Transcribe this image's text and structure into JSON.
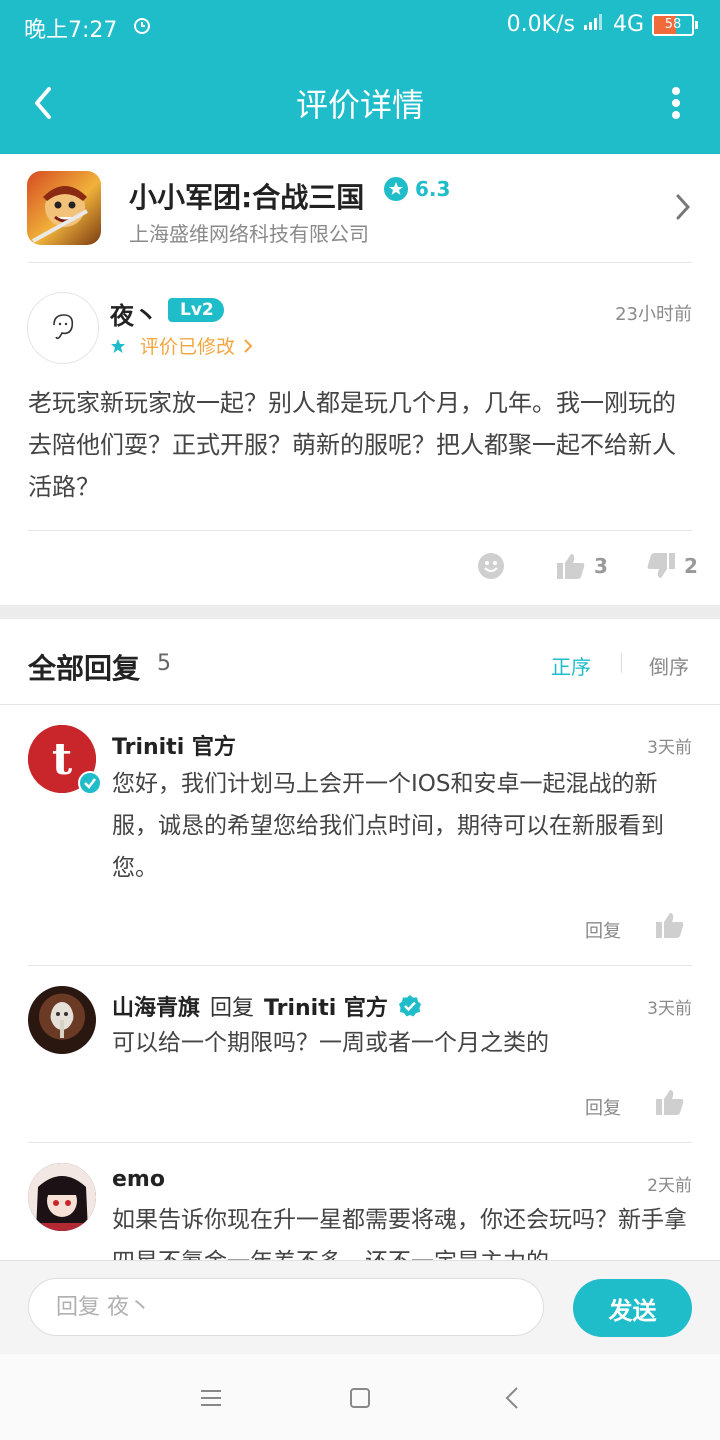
{
  "status_bar": {
    "time": "晚上7:27",
    "network_speed": "0.0K/s",
    "network_type": "4G",
    "battery": "58"
  },
  "header": {
    "title": "评价详情"
  },
  "app": {
    "name": "小小军团:合战三国",
    "rating": "6.3",
    "developer": "上海盛维网络科技有限公司"
  },
  "review": {
    "user": "夜丶",
    "level": "Lv2",
    "time": "23小时前",
    "modified_label": "评价已修改",
    "text": "老玩家新玩家放一起？别人都是玩几个月，几年。我一刚玩的去陪他们耍？正式开服？萌新的服呢？把人都聚一起不给新人活路？",
    "likes": "3",
    "dislikes": "2"
  },
  "replies_section": {
    "title": "全部回复",
    "count": "5",
    "sort_asc": "正序",
    "sort_desc": "倒序",
    "reply_label": "回复"
  },
  "replies": [
    {
      "user": "Triniti 官方",
      "avatar_letter": "t",
      "time": "3天前",
      "text": "您好，我们计划马上会开一个IOS和安卓一起混战的新服，诚恳的希望您给我们点时间，期待可以在新服看到您。"
    },
    {
      "user": "山海青旗",
      "reply_word": "回复",
      "reply_to": "Triniti 官方",
      "time": "3天前",
      "text": "可以给一个期限吗？一周或者一个月之类的"
    },
    {
      "user": "emo",
      "time": "2天前",
      "text": "如果告诉你现在升一星都需要将魂，你还会玩吗？新手拿四星不氪金一年差不多，还不一定是主力的"
    }
  ],
  "composer": {
    "placeholder": "回复 夜丶",
    "send_label": "发送"
  },
  "colors": {
    "accent": "#1fbcca",
    "modified": "#f3a640",
    "official_red": "#c8262a"
  }
}
